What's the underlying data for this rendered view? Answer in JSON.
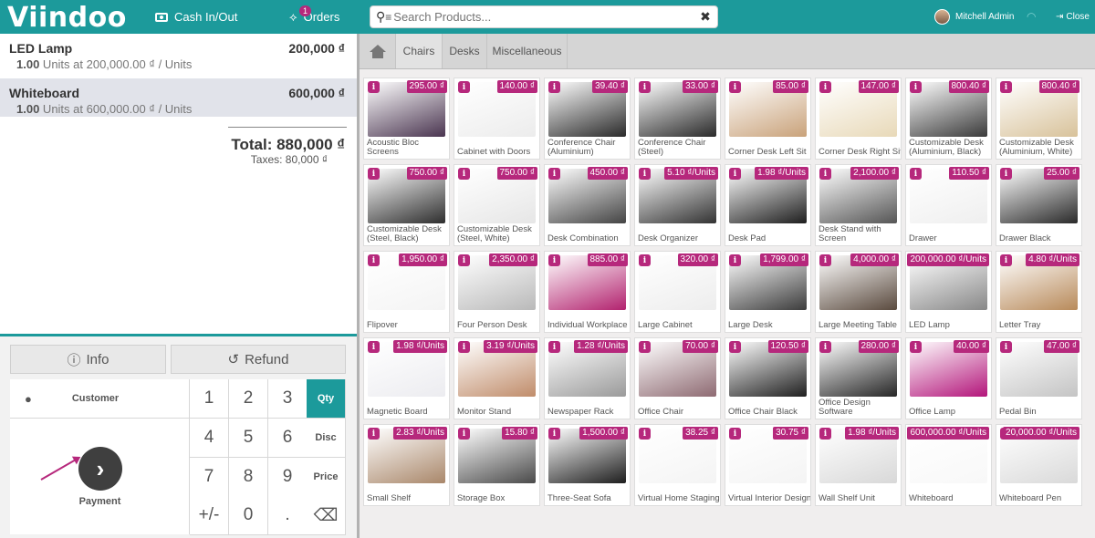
{
  "topbar": {
    "logo": "Viindoo",
    "cash_label": "Cash In/Out",
    "orders_label": "Orders",
    "orders_badge": "1",
    "search_placeholder": "Search Products...",
    "user_name": "Mitchell Admin",
    "close_label": "Close"
  },
  "orderlines": [
    {
      "name": "LED Lamp",
      "price": "200,000 ₫",
      "qty": "1.00",
      "unit_info": " Units at 200,000.00 ₫ / Units"
    },
    {
      "name": "Whiteboard",
      "price": "600,000 ₫",
      "qty": "1.00",
      "unit_info": " Units at 600,000.00 ₫ / Units"
    }
  ],
  "summary": {
    "total": "Total: 880,000 ₫",
    "taxes": "Taxes: 80,000 ₫"
  },
  "actions": {
    "info": "Info",
    "refund": "Refund"
  },
  "pad": {
    "customer": "Customer",
    "payment": "Payment",
    "keys": [
      "1",
      "2",
      "3",
      "Qty",
      "4",
      "5",
      "6",
      "Disc",
      "7",
      "8",
      "9",
      "Price",
      "+/-",
      "0",
      ".",
      "⌫"
    ],
    "active_mode": "Qty"
  },
  "categories": [
    "Chairs",
    "Desks",
    "Miscellaneous"
  ],
  "products": [
    {
      "name": "Acoustic Bloc Screens",
      "price": "295.00 ₫",
      "color": "#4a3550"
    },
    {
      "name": "Cabinet with Doors",
      "price": "140.00 ₫",
      "color": "#ececec"
    },
    {
      "name": "Conference Chair (Aluminium)",
      "price": "39.40 ₫",
      "color": "#2a2a2a"
    },
    {
      "name": "Conference Chair (Steel)",
      "price": "33.00 ₫",
      "color": "#2a2a2a"
    },
    {
      "name": "Corner Desk Left Sit",
      "price": "85.00 ₫",
      "color": "#c9a27a"
    },
    {
      "name": "Corner Desk Right Sit",
      "price": "147.00 ₫",
      "color": "#e8d9b8"
    },
    {
      "name": "Customizable Desk (Aluminium, Black)",
      "price": "800.40 ₫",
      "color": "#3a3a3a"
    },
    {
      "name": "Customizable Desk (Aluminium, White)",
      "price": "800.40 ₫",
      "color": "#d8c29a"
    },
    {
      "name": "Customizable Desk (Steel, Black)",
      "price": "750.00 ₫",
      "color": "#2e2e2e"
    },
    {
      "name": "Customizable Desk (Steel, White)",
      "price": "750.00 ₫",
      "color": "#e6e6e6"
    },
    {
      "name": "Desk Combination",
      "price": "450.00 ₫",
      "color": "#444444"
    },
    {
      "name": "Desk Organizer",
      "price": "5.10 ₫/Units",
      "color": "#333333"
    },
    {
      "name": "Desk Pad",
      "price": "1.98 ₫/Units",
      "color": "#1e1e1e"
    },
    {
      "name": "Desk Stand with Screen",
      "price": "2,100.00 ₫",
      "color": "#555555"
    },
    {
      "name": "Drawer",
      "price": "110.50 ₫",
      "color": "#efefef"
    },
    {
      "name": "Drawer Black",
      "price": "25.00 ₫",
      "color": "#2a2a2a"
    },
    {
      "name": "Flipover",
      "price": "1,950.00 ₫",
      "color": "#f4f4f4"
    },
    {
      "name": "Four Person Desk",
      "price": "2,350.00 ₫",
      "color": "#b9b9b9"
    },
    {
      "name": "Individual Workplace",
      "price": "885.00 ₫",
      "color": "#b2226e"
    },
    {
      "name": "Large Cabinet",
      "price": "320.00 ₫",
      "color": "#ededed"
    },
    {
      "name": "Large Desk",
      "price": "1,799.00 ₫",
      "color": "#3c3c3c"
    },
    {
      "name": "Large Meeting Table",
      "price": "4,000.00 ₫",
      "color": "#5a4a3e"
    },
    {
      "name": "LED Lamp",
      "price": "200,000.00 ₫/Units",
      "color": "#888888"
    },
    {
      "name": "Letter Tray",
      "price": "4.80 ₫/Units",
      "color": "#b88a5a"
    },
    {
      "name": "Magnetic Board",
      "price": "1.98 ₫/Units",
      "color": "#ececf0"
    },
    {
      "name": "Monitor Stand",
      "price": "3.19 ₫/Units",
      "color": "#c08c6a"
    },
    {
      "name": "Newspaper Rack",
      "price": "1.28 ₫/Units",
      "color": "#9a9a9a"
    },
    {
      "name": "Office Chair",
      "price": "70.00 ₫",
      "color": "#8e6a72"
    },
    {
      "name": "Office Chair Black",
      "price": "120.50 ₫",
      "color": "#1f1f1f"
    },
    {
      "name": "Office Design Software",
      "price": "280.00 ₫",
      "color": "#262626"
    },
    {
      "name": "Office Lamp",
      "price": "40.00 ₫",
      "color": "#b3157a"
    },
    {
      "name": "Pedal Bin",
      "price": "47.00 ₫",
      "color": "#c4c4c4"
    },
    {
      "name": "Small Shelf",
      "price": "2.83 ₫/Units",
      "color": "#a9876a"
    },
    {
      "name": "Storage Box",
      "price": "15.80 ₫",
      "color": "#4a4a4a"
    },
    {
      "name": "Three-Seat Sofa",
      "price": "1,500.00 ₫",
      "color": "#1e1e1e"
    },
    {
      "name": "Virtual Home Staging",
      "price": "38.25 ₫",
      "color": "#f4f4f4"
    },
    {
      "name": "Virtual Interior Design",
      "price": "30.75 ₫",
      "color": "#f4f4f4"
    },
    {
      "name": "Wall Shelf Unit",
      "price": "1.98 ₫/Units",
      "color": "#d8d8d8"
    },
    {
      "name": "Whiteboard",
      "price": "600,000.00 ₫/Units",
      "color": "#f8f8f8"
    },
    {
      "name": "Whiteboard Pen",
      "price": "20,000.00 ₫/Units",
      "color": "#d9d9d9"
    }
  ],
  "icons": {
    "search": "magnifier-icon",
    "database": "database-icon",
    "clear": "close-x-icon",
    "wifi": "wifi-icon",
    "close": "sign-out-icon",
    "info": "info-icon",
    "refund": "undo-icon",
    "customer": "user-icon",
    "payment": "chevron-right-icon",
    "backspace": "backspace-icon",
    "home": "home-icon"
  },
  "colors": {
    "primary": "#1c9a9b",
    "accent": "#b6287c"
  }
}
